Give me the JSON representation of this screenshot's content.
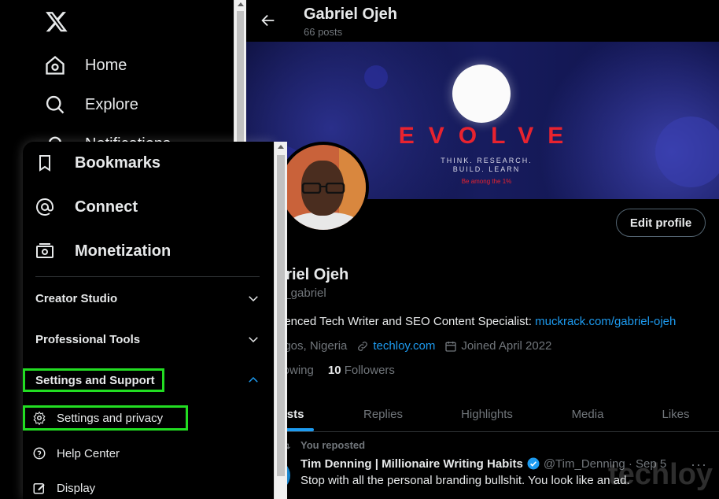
{
  "left_nav": {
    "items": [
      {
        "label": "Home",
        "icon": "home-icon"
      },
      {
        "label": "Explore",
        "icon": "search-icon"
      },
      {
        "label": "Notifications",
        "icon": "bell-icon"
      }
    ]
  },
  "header": {
    "name": "Gabriel Ojeh",
    "posts": "66 posts"
  },
  "banner": {
    "title": "EVOLVE",
    "tagline_line1": "THINK. RESEARCH.",
    "tagline_line2": "BUILD. LEARN",
    "small": "Be among the 1%"
  },
  "profile": {
    "edit_label": "Edit profile",
    "name": "briel Ojeh",
    "handle": "h_gabriel",
    "bio_text": "rienced Tech Writer and SEO Content Specialist: ",
    "bio_link": "muckrack.com/gabriel-ojeh",
    "location": "agos, Nigeria",
    "website": "techloy.com",
    "joined": "Joined April 2022",
    "following_label": "llowing",
    "followers_count": "10",
    "followers_label": "Followers"
  },
  "tabs": [
    {
      "label": "osts",
      "active": true
    },
    {
      "label": "Replies"
    },
    {
      "label": "Highlights"
    },
    {
      "label": "Media"
    },
    {
      "label": "Likes"
    }
  ],
  "tweet": {
    "repost_label": "You reposted",
    "author": "Tim Denning | Millionaire Writing Habits",
    "handle_time": "@Tim_Denning · Sep 5",
    "text": "Stop with all the personal branding bullshit. You look like an ad.",
    "more": "···",
    "watermark": "techloy"
  },
  "popup": {
    "items": [
      {
        "label": "Bookmarks",
        "icon": "bookmark-icon"
      },
      {
        "label": "Connect",
        "icon": "at-icon"
      },
      {
        "label": "Monetization",
        "icon": "money-icon"
      }
    ],
    "sections": [
      {
        "label": "Creator Studio",
        "expanded": false
      },
      {
        "label": "Professional Tools",
        "expanded": false
      },
      {
        "label": "Settings and Support",
        "expanded": true
      }
    ],
    "sub_items": [
      {
        "label": "Settings and privacy",
        "icon": "gear-icon"
      },
      {
        "label": "Help Center",
        "icon": "help-icon"
      },
      {
        "label": "Display",
        "icon": "edit-icon"
      }
    ]
  },
  "colors": {
    "accent": "#1d9bf0",
    "highlight": "#22dd22",
    "brand_red": "#e8232f"
  }
}
